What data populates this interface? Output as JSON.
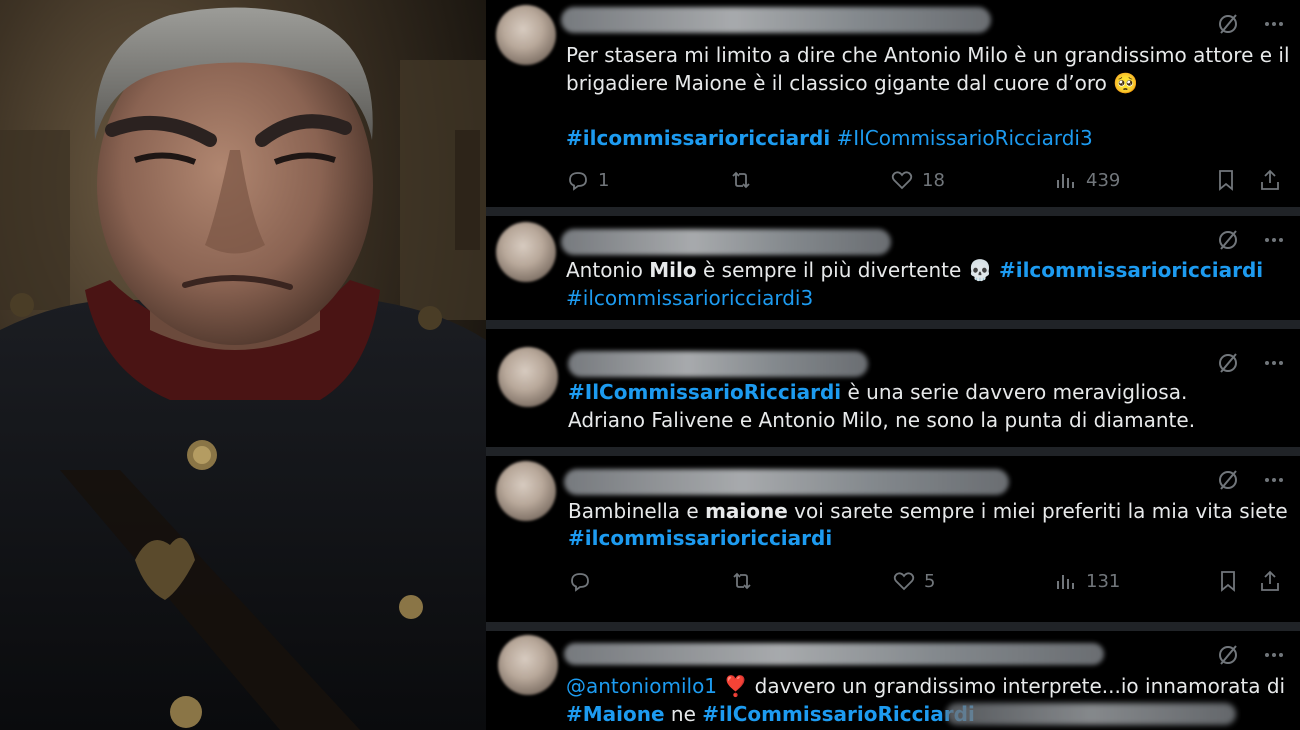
{
  "tweets": [
    {
      "line1": "Per stasera mi limito a dire che Antonio Milo è un grandissimo attore e il",
      "line2": "brigadiere Maione è il classico gigante dal cuore d’oro 🥺",
      "tag1": "#ilcommissarioricciardi",
      "tag2": "#IlCommissarioRicciardi3",
      "replies": "1",
      "likes": "18",
      "views": "439"
    },
    {
      "pre": "Antonio ",
      "bold": "Milo",
      "mid": " è sempre il più divertente 💀 ",
      "tag1": "#ilcommissarioricciardi",
      "tag2": "#ilcommissarioricciardi3"
    },
    {
      "tag1": "#IlCommissarioRicciardi",
      "line1": " è una serie davvero meravigliosa.",
      "line2": "Adriano Falivene e Antonio Milo, ne sono la punta di diamante."
    },
    {
      "pre": "Bambinella e ",
      "bold": "maione",
      "post": " voi sarete sempre i miei preferiti la mia vita siete",
      "tag1": "#ilcommissarioricciardi",
      "likes": "5",
      "views": "131"
    },
    {
      "mention": "@antoniomilo1",
      "heart": "❣️",
      "line1": " davvero un grandissimo interprete...io innamorata di",
      "tag1": "#Maione",
      "mid": " ne ",
      "tag2": "#ilCommissarioRicciardi"
    }
  ],
  "colors": {
    "link": "#1d9bf0",
    "text": "#e7e9ea",
    "muted": "#71767b",
    "separator": "#202327"
  },
  "icons": [
    "grok-slash-icon",
    "more-icon",
    "reply-icon",
    "retweet-icon",
    "like-icon",
    "views-icon",
    "bookmark-icon",
    "share-icon"
  ]
}
